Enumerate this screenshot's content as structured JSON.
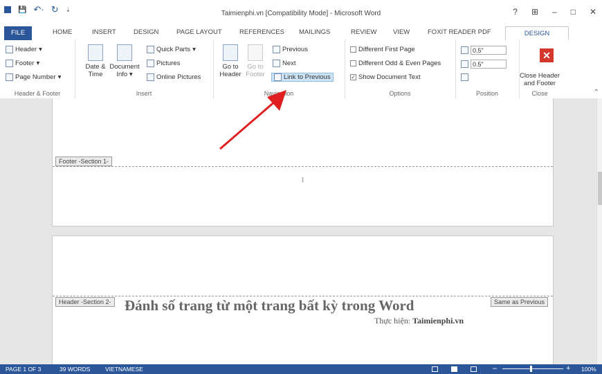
{
  "window": {
    "title": "Taimienphi.vn [Compatibility Mode] - Microsoft Word",
    "help": "?",
    "display_options": "⊞",
    "minimize": "–",
    "maximize": "□",
    "close": "✕",
    "qat": {
      "save": "💾",
      "undo": "↶·",
      "redo": "↻",
      "customize": "⇣"
    }
  },
  "tabs": {
    "file": "FILE",
    "home": "HOME",
    "insert": "INSERT",
    "design": "DESIGN",
    "page_layout": "PAGE LAYOUT",
    "references": "REFERENCES",
    "mailings": "MAILINGS",
    "review": "REVIEW",
    "view": "VIEW",
    "foxit": "FOXIT READER PDF",
    "hf_design": "DESIGN"
  },
  "ribbon": {
    "header_footer": {
      "header": "Header",
      "footer": "Footer",
      "page_number": "Page Number",
      "label": "Header & Footer"
    },
    "insert": {
      "date_time_1": "Date &",
      "date_time_2": "Time",
      "doc_info_1": "Document",
      "doc_info_2": "Info",
      "quick_parts": "Quick Parts",
      "pictures": "Pictures",
      "online_pictures": "Online Pictures",
      "label": "Insert"
    },
    "navigation": {
      "goto_header_1": "Go to",
      "goto_header_2": "Header",
      "goto_footer_1": "Go to",
      "goto_footer_2": "Footer",
      "previous": "Previous",
      "next": "Next",
      "link_to_previous": "Link to Previous",
      "label": "Navigation"
    },
    "options": {
      "different_first_page": "Different First Page",
      "different_odd_even": "Different Odd & Even Pages",
      "show_document_text": "Show Document Text",
      "show_document_text_checked": true,
      "label": "Options"
    },
    "position": {
      "header_from_top": "0.5\"",
      "footer_from_bottom": "0.5\"",
      "label": "Position"
    },
    "close": {
      "close_1": "Close Header",
      "close_2": "and Footer",
      "label": "Close"
    }
  },
  "document": {
    "footer_tag": "Footer -Section 1-",
    "page_number": "1",
    "header_tag": "Header -Section 2-",
    "same_as_previous": "Same as Previous",
    "heading": "Đánh số trang từ một trang bất kỳ trong Word",
    "credit_prefix": "Thực hiện: ",
    "credit_site": "Taimienphi.vn"
  },
  "status": {
    "page": "PAGE 1 OF 3",
    "words": "39 WORDS",
    "language": "VIETNAMESE",
    "zoom": "100%",
    "zoom_level_percent": 100
  },
  "colors": {
    "accent": "#2b579a",
    "close_red": "#d4372c",
    "arrow": "#e02020"
  }
}
